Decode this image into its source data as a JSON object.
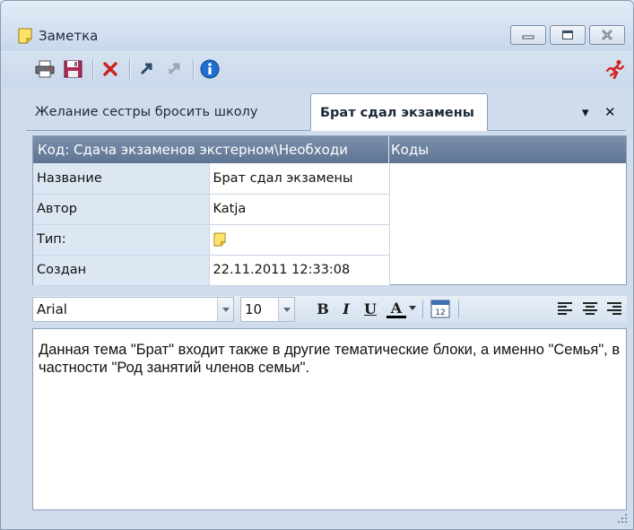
{
  "window": {
    "title": "Заметка"
  },
  "tabs": [
    {
      "label": "Желание сестры бросить школу",
      "active": false
    },
    {
      "label": "Брат сдал экзамены",
      "active": true
    }
  ],
  "tab_controls": {
    "menu": "▾",
    "close": "✕"
  },
  "props": {
    "code": "Код: Сдача экзаменов экстерном\\Необходи",
    "codes_header": "Коды",
    "rows": [
      {
        "key": "Название",
        "value": "Брат сдал экзамены"
      },
      {
        "key": "Автор",
        "value": "Katja"
      },
      {
        "key": "Тип:",
        "value": ""
      },
      {
        "key": "Создан",
        "value": "22.11.2011 12:33:08"
      }
    ]
  },
  "format": {
    "font": "Arial",
    "size": "10",
    "bold": "B",
    "italic": "I",
    "underline": "U",
    "color": "A",
    "calendar_day": "12"
  },
  "editor": {
    "text": "Данная тема \"Брат\" входит также в другие тематические блоки, а именно \"Семья\", в частности \"Род занятий членов семьи\"."
  },
  "colors": {
    "accent": "#5e7493",
    "delete": "#cc2222",
    "info": "#1f6fd0"
  }
}
